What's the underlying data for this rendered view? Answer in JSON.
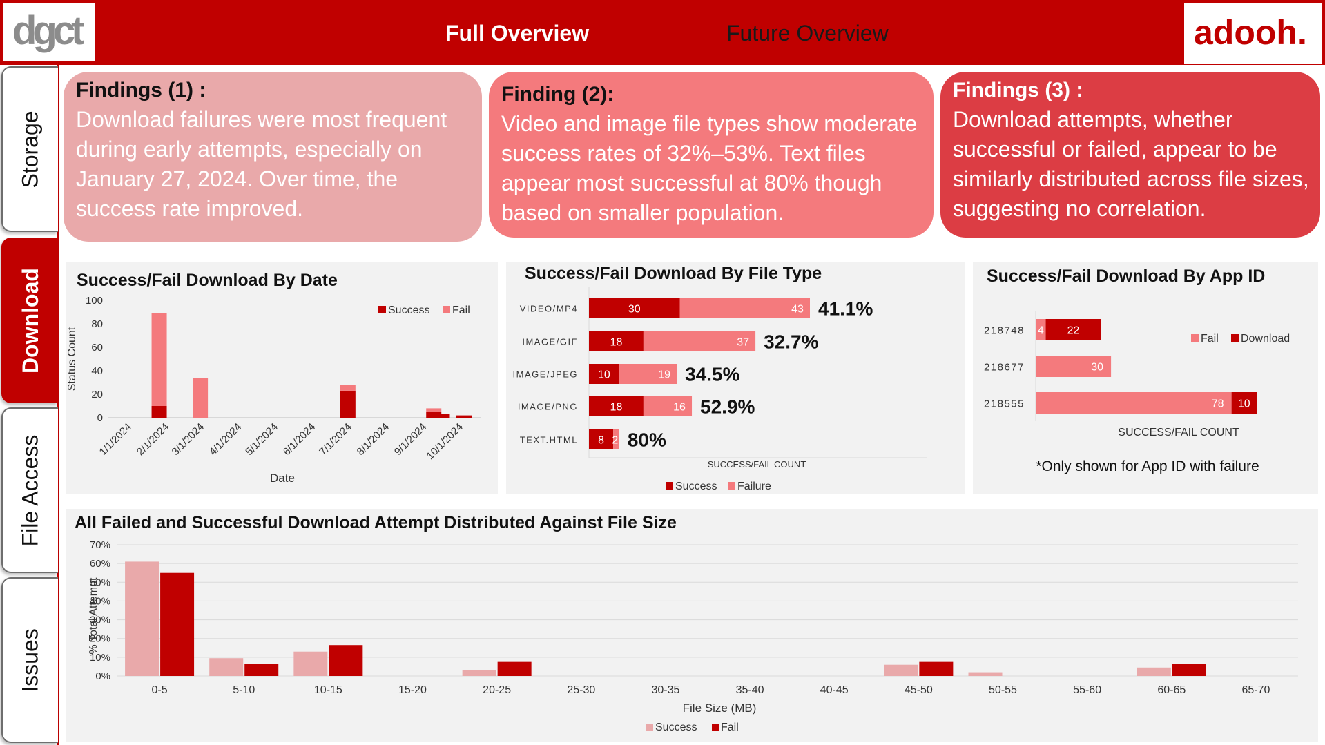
{
  "header": {
    "logo_left_text": "dgct",
    "logo_right_text": "adooh.",
    "tabs": [
      {
        "label": "Full Overview",
        "active": true
      },
      {
        "label": "Future Overview",
        "active": false
      }
    ],
    "accent_color": "#c00000"
  },
  "sidebar": {
    "items": [
      {
        "label": "Storage",
        "active": false
      },
      {
        "label": "Download",
        "active": true
      },
      {
        "label": "File Access",
        "active": false
      },
      {
        "label": "Issues",
        "active": false
      }
    ]
  },
  "findings": [
    {
      "title": "Findings (1) :",
      "text": "Download failures were most frequent during early attempts, especially on January 27, 2024. Over time, the success rate improved."
    },
    {
      "title": "Finding (2):",
      "text": "Video and image file types show moderate success rates of 32%–53%. Text files appear most successful at 80% though based on smaller population."
    },
    {
      "title": "Findings (3) :",
      "text": "Download attempts, whether successful or failed, appear to be similarly distributed across file sizes, suggesting no correlation."
    }
  ],
  "colors": {
    "success": "#c00000",
    "fail": "#f47a7d",
    "fail_light": "#e9a9aa",
    "panel": "#f2f2f2"
  },
  "chart_data": [
    {
      "type": "bar",
      "stacked": true,
      "title": "Success/Fail Download By Date",
      "xlabel": "Date",
      "ylabel": "Status Count",
      "ylim": [
        0,
        100
      ],
      "yticks": [
        0,
        20,
        40,
        60,
        80,
        100
      ],
      "x_tick_labels": [
        "1/1/2024",
        "2/1/2024",
        "3/1/2024",
        "4/1/2024",
        "5/1/2024",
        "6/1/2024",
        "7/1/2024",
        "8/1/2024",
        "9/1/2024",
        "10/1/2024"
      ],
      "legend_position": "top-right",
      "series": [
        {
          "name": "Success",
          "points": [
            {
              "x": "1/27/2024",
              "y": 10
            },
            {
              "x": "7/1/2024",
              "y": 23
            },
            {
              "x": "9/10/2024",
              "y": 5
            },
            {
              "x": "9/17/2024",
              "y": 3
            },
            {
              "x": "10/5/2024",
              "y": 2
            }
          ]
        },
        {
          "name": "Fail",
          "points": [
            {
              "x": "1/27/2024",
              "y": 79
            },
            {
              "x": "3/1/2024",
              "y": 34
            },
            {
              "x": "7/1/2024",
              "y": 5
            },
            {
              "x": "9/10/2024",
              "y": 3
            },
            {
              "x": "9/17/2024",
              "y": 0
            },
            {
              "x": "10/5/2024",
              "y": 0
            }
          ]
        }
      ]
    },
    {
      "type": "bar",
      "orientation": "horizontal",
      "stacked": true,
      "title": "Success/Fail Download By File Type",
      "xlabel": "SUCCESS/FAIL COUNT",
      "categories": [
        "VIDEO/MP4",
        "IMAGE/GIF",
        "IMAGE/JPEG",
        "IMAGE/PNG",
        "TEXT.HTML"
      ],
      "series": [
        {
          "name": "Success",
          "values": [
            30,
            18,
            10,
            18,
            8
          ]
        },
        {
          "name": "Failure",
          "values": [
            43,
            37,
            19,
            16,
            2
          ]
        }
      ],
      "rate_labels": [
        "41.1%",
        "32.7%",
        "34.5%",
        "52.9%",
        "80%"
      ],
      "legend_position": "bottom"
    },
    {
      "type": "bar",
      "orientation": "horizontal",
      "stacked": true,
      "title": "Success/Fail Download By App ID",
      "xlabel": "SUCCESS/FAIL COUNT",
      "categories": [
        "218748",
        "218677",
        "218555"
      ],
      "series": [
        {
          "name": "Fail",
          "values": [
            4,
            30,
            78
          ]
        },
        {
          "name": "Download",
          "values": [
            22,
            0,
            10
          ]
        }
      ],
      "note": "*Only shown for App ID with failure",
      "legend_position": "top-right"
    },
    {
      "type": "bar",
      "title": "All Failed and Successful Download Attempt Distributed Against File Size",
      "xlabel": "File Size (MB)",
      "ylabel": "% Total Attempt",
      "ylim": [
        0,
        70
      ],
      "yticks": [
        "0%",
        "10%",
        "20%",
        "30%",
        "40%",
        "50%",
        "60%",
        "70%"
      ],
      "categories": [
        "0-5",
        "5-10",
        "10-15",
        "15-20",
        "20-25",
        "25-30",
        "30-35",
        "35-40",
        "40-45",
        "45-50",
        "50-55",
        "55-60",
        "60-65",
        "65-70"
      ],
      "series": [
        {
          "name": "Success",
          "values": [
            61,
            9.5,
            13,
            0,
            3,
            0,
            0,
            0,
            0,
            6,
            2,
            0,
            4.5,
            0
          ]
        },
        {
          "name": "Fail",
          "values": [
            55,
            6.5,
            16.5,
            0,
            7.5,
            0,
            0,
            0,
            0,
            7.5,
            0,
            0,
            6.5,
            0
          ]
        }
      ],
      "legend_position": "bottom"
    }
  ]
}
